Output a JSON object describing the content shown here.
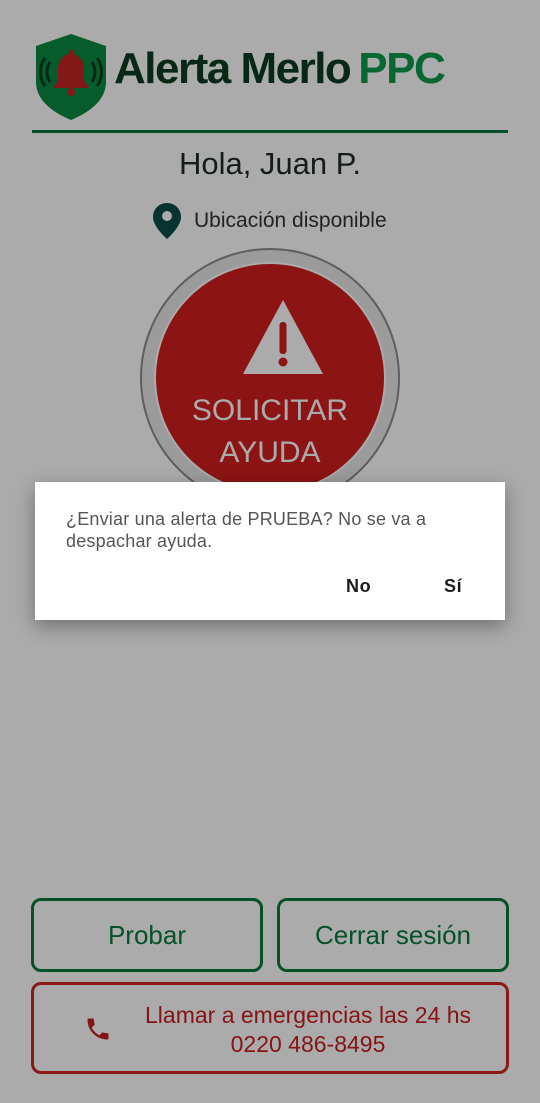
{
  "header": {
    "title_main": "Alerta Merlo",
    "title_accent": "PPC",
    "logo_icon": "bell-shield-icon"
  },
  "greeting": "Hola, Juan P.",
  "location": {
    "icon": "location-pin-icon",
    "text": "Ubicación disponible"
  },
  "sos_button": {
    "icon": "warning-icon",
    "line1": "SOLICITAR",
    "line2": "AYUDA"
  },
  "buttons": {
    "test": "Probar",
    "logout": "Cerrar sesión",
    "call_line1": "Llamar a emergencias las 24 hs",
    "call_line2": "0220 486-8495",
    "call_icon": "phone-icon"
  },
  "dialog": {
    "message": "¿Enviar una alerta de PRUEBA? No se va a despachar ayuda.",
    "no_label": "No",
    "yes_label": "Sí"
  },
  "colors": {
    "brand_green": "#0a7a3c",
    "brand_dark_green": "#0b3d22",
    "alert_red": "#d31e1e"
  }
}
